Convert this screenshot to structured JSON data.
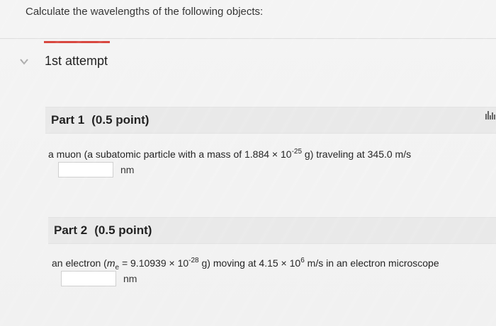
{
  "prompt": "Calculate the wavelengths of the following objects:",
  "attempt": {
    "label": "1st attempt"
  },
  "parts": [
    {
      "title": "Part 1",
      "points": "(0.5 point)",
      "question_before": "a muon (a subatomic particle with a mass of 1.884 × 10",
      "question_exp": "-25",
      "question_after": " g) traveling at 345.0 m/s",
      "answer_value": "",
      "unit": "nm"
    },
    {
      "title": "Part 2",
      "points": "(0.5 point)",
      "question_start": "an electron (",
      "question_symbol": "m",
      "question_sub": "e",
      "question_mid": " = 9.10939 × 10",
      "question_exp1": "-28",
      "question_mid2": " g) moving at 4.15 × 10",
      "question_exp2": "6",
      "question_end": " m/s in an electron microscope",
      "answer_value": "",
      "unit": "nm"
    }
  ],
  "icons": {
    "chevron": "chevron-down-icon",
    "stats": "bar-chart-icon"
  },
  "colors": {
    "accent": "#d8473f",
    "header_bg": "#e9e9e9",
    "chevron": "#a9a9a9"
  }
}
